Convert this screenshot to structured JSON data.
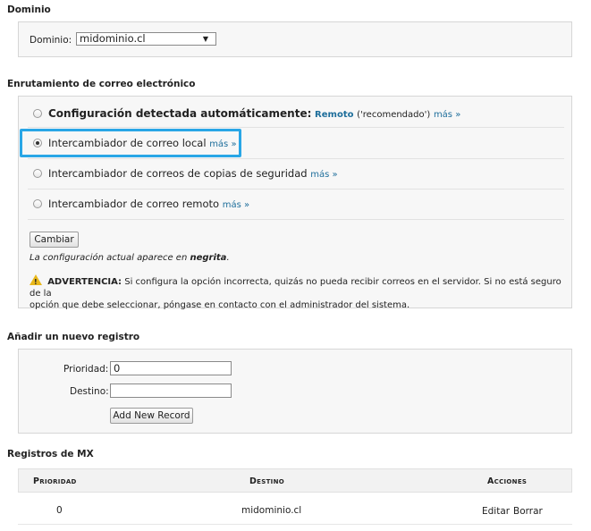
{
  "domain_section": {
    "title": "Dominio",
    "label": "Dominio:",
    "selected": "midominio.cl"
  },
  "routing_section": {
    "title": "Enrutamiento de correo electrónico",
    "options": [
      {
        "label": "Configuración detectada automáticamente:",
        "detected": "Remoto",
        "suffix": "('recomendado')",
        "more": "más »",
        "checked": false
      },
      {
        "label": "Intercambiador de correo local",
        "more": "más »",
        "checked": true
      },
      {
        "label": "Intercambiador de correos de copias de seguridad",
        "more": "más »",
        "checked": false
      },
      {
        "label": "Intercambiador de correo remoto",
        "more": "más »",
        "checked": false
      }
    ],
    "change_button": "Cambiar",
    "note_prefix": "La configuración actual aparece en",
    "note_bold": "negrita",
    "note_end": ".",
    "warning_title": "ADVERTENCIA:",
    "warning_line1": "Si configura la opción incorrecta, quizás no pueda recibir correos en el servidor. Si no está seguro de la",
    "warning_line2": "opción que debe seleccionar, póngase en contacto con el administrador del sistema."
  },
  "add_section": {
    "title": "Añadir un nuevo registro",
    "priority_label": "Prioridad:",
    "priority_value": "0",
    "destination_label": "Destino:",
    "destination_value": "",
    "add_button": "Add New Record"
  },
  "mx_section": {
    "title": "Registros de MX",
    "headers": {
      "priority": "Prioridad",
      "destination": "Destino",
      "actions": "Acciones"
    },
    "rows": [
      {
        "priority": "0",
        "destination": "midominio.cl",
        "edit": "Editar",
        "delete": "Borrar"
      }
    ]
  },
  "colors": {
    "link": "#1e6e9b",
    "highlight": "#29a6e6",
    "warning": "#e9b81b"
  }
}
